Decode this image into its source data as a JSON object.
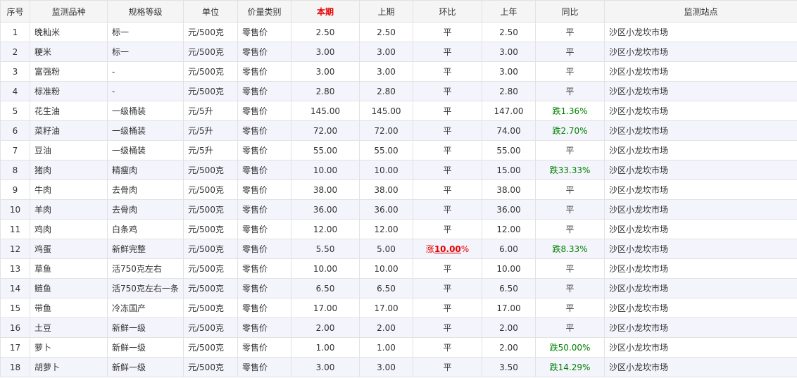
{
  "columns": [
    "序号",
    "监测品种",
    "规格等级",
    "单位",
    "价量类别",
    "本期",
    "上期",
    "环比",
    "上年",
    "同比",
    "监测站点"
  ],
  "rows": [
    {
      "no": "1",
      "item": "晚籼米",
      "spec": "标一",
      "unit": "元/500克",
      "type": "零售价",
      "cur": "2.50",
      "prev": "2.50",
      "mom": "平",
      "last": "2.50",
      "yoy": "平",
      "site": "沙区小龙坎市场"
    },
    {
      "no": "2",
      "item": "粳米",
      "spec": "标一",
      "unit": "元/500克",
      "type": "零售价",
      "cur": "3.00",
      "prev": "3.00",
      "mom": "平",
      "last": "3.00",
      "yoy": "平",
      "site": "沙区小龙坎市场"
    },
    {
      "no": "3",
      "item": "富强粉",
      "spec": "-",
      "unit": "元/500克",
      "type": "零售价",
      "cur": "3.00",
      "prev": "3.00",
      "mom": "平",
      "last": "3.00",
      "yoy": "平",
      "site": "沙区小龙坎市场"
    },
    {
      "no": "4",
      "item": "标准粉",
      "spec": "-",
      "unit": "元/500克",
      "type": "零售价",
      "cur": "2.80",
      "prev": "2.80",
      "mom": "平",
      "last": "2.80",
      "yoy": "平",
      "site": "沙区小龙坎市场"
    },
    {
      "no": "5",
      "item": "花生油",
      "spec": "一级桶装",
      "unit": "元/5升",
      "type": "零售价",
      "cur": "145.00",
      "prev": "145.00",
      "mom": "平",
      "last": "147.00",
      "yoy": "跌1.36%",
      "site": "沙区小龙坎市场"
    },
    {
      "no": "6",
      "item": "菜籽油",
      "spec": "一级桶装",
      "unit": "元/5升",
      "type": "零售价",
      "cur": "72.00",
      "prev": "72.00",
      "mom": "平",
      "last": "74.00",
      "yoy": "跌2.70%",
      "site": "沙区小龙坎市场"
    },
    {
      "no": "7",
      "item": "豆油",
      "spec": "一级桶装",
      "unit": "元/5升",
      "type": "零售价",
      "cur": "55.00",
      "prev": "55.00",
      "mom": "平",
      "last": "55.00",
      "yoy": "平",
      "site": "沙区小龙坎市场"
    },
    {
      "no": "8",
      "item": "猪肉",
      "spec": "精瘦肉",
      "unit": "元/500克",
      "type": "零售价",
      "cur": "10.00",
      "prev": "10.00",
      "mom": "平",
      "last": "15.00",
      "yoy": "跌33.33%",
      "site": "沙区小龙坎市场"
    },
    {
      "no": "9",
      "item": "牛肉",
      "spec": "去骨肉",
      "unit": "元/500克",
      "type": "零售价",
      "cur": "38.00",
      "prev": "38.00",
      "mom": "平",
      "last": "38.00",
      "yoy": "平",
      "site": "沙区小龙坎市场"
    },
    {
      "no": "10",
      "item": "羊肉",
      "spec": "去骨肉",
      "unit": "元/500克",
      "type": "零售价",
      "cur": "36.00",
      "prev": "36.00",
      "mom": "平",
      "last": "36.00",
      "yoy": "平",
      "site": "沙区小龙坎市场"
    },
    {
      "no": "11",
      "item": "鸡肉",
      "spec": "白条鸡",
      "unit": "元/500克",
      "type": "零售价",
      "cur": "12.00",
      "prev": "12.00",
      "mom": "平",
      "last": "12.00",
      "yoy": "平",
      "site": "沙区小龙坎市场"
    },
    {
      "no": "12",
      "item": "鸡蛋",
      "spec": "新鲜完整",
      "unit": "元/500克",
      "type": "零售价",
      "cur": "5.50",
      "prev": "5.00",
      "mom": "涨10.00%",
      "last": "6.00",
      "yoy": "跌8.33%",
      "site": "沙区小龙坎市场"
    },
    {
      "no": "13",
      "item": "草鱼",
      "spec": "活750克左右",
      "unit": "元/500克",
      "type": "零售价",
      "cur": "10.00",
      "prev": "10.00",
      "mom": "平",
      "last": "10.00",
      "yoy": "平",
      "site": "沙区小龙坎市场"
    },
    {
      "no": "14",
      "item": "鲢鱼",
      "spec": "活750克左右一条",
      "unit": "元/500克",
      "type": "零售价",
      "cur": "6.50",
      "prev": "6.50",
      "mom": "平",
      "last": "6.50",
      "yoy": "平",
      "site": "沙区小龙坎市场"
    },
    {
      "no": "15",
      "item": "带鱼",
      "spec": "冷冻国产",
      "unit": "元/500克",
      "type": "零售价",
      "cur": "17.00",
      "prev": "17.00",
      "mom": "平",
      "last": "17.00",
      "yoy": "平",
      "site": "沙区小龙坎市场"
    },
    {
      "no": "16",
      "item": "土豆",
      "spec": "新鲜一级",
      "unit": "元/500克",
      "type": "零售价",
      "cur": "2.00",
      "prev": "2.00",
      "mom": "平",
      "last": "2.00",
      "yoy": "平",
      "site": "沙区小龙坎市场"
    },
    {
      "no": "17",
      "item": "萝卜",
      "spec": "新鲜一级",
      "unit": "元/500克",
      "type": "零售价",
      "cur": "1.00",
      "prev": "1.00",
      "mom": "平",
      "last": "2.00",
      "yoy": "跌50.00%",
      "site": "沙区小龙坎市场"
    },
    {
      "no": "18",
      "item": "胡萝卜",
      "spec": "新鲜一级",
      "unit": "元/500克",
      "type": "零售价",
      "cur": "3.00",
      "prev": "3.00",
      "mom": "平",
      "last": "3.50",
      "yoy": "跌14.29%",
      "site": "沙区小龙坎市场"
    }
  ]
}
